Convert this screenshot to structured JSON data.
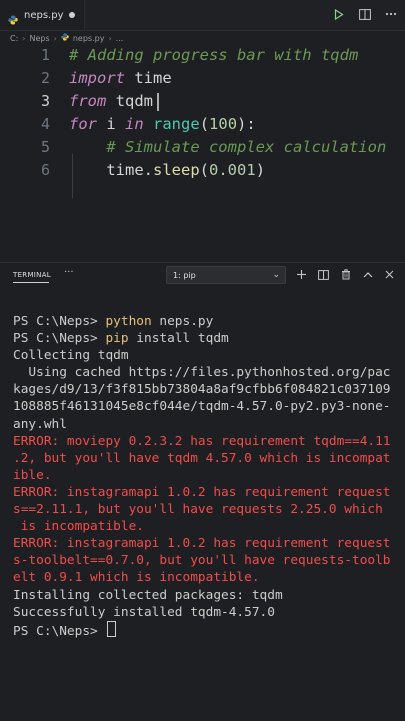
{
  "tabbar": {
    "tab_name": "neps.py",
    "icons": [
      "python-icon",
      "dirty-dot-icon",
      "run-icon",
      "split-editor-icon",
      "more-icon"
    ]
  },
  "breadcrumb": {
    "drive": "C:",
    "folder": "Neps",
    "file": "neps.py",
    "tail": "..."
  },
  "editor": {
    "active_line": 3,
    "lines": [
      {
        "n": "1",
        "segs": [
          {
            "t": "# Adding progress bar with tqdm",
            "c": "cm"
          }
        ]
      },
      {
        "n": "2",
        "segs": [
          {
            "t": "import",
            "c": "kw"
          },
          {
            "t": " time",
            "c": "pl"
          }
        ]
      },
      {
        "n": "3",
        "segs": [
          {
            "t": "from",
            "c": "kw"
          },
          {
            "t": " tqdm",
            "c": "pl"
          }
        ]
      },
      {
        "n": "4",
        "segs": [
          {
            "t": "for",
            "c": "kw"
          },
          {
            "t": " i ",
            "c": "pl"
          },
          {
            "t": "in",
            "c": "kw"
          },
          {
            "t": " ",
            "c": "pl"
          },
          {
            "t": "range",
            "c": "bi"
          },
          {
            "t": "(",
            "c": "pl"
          },
          {
            "t": "100",
            "c": "num"
          },
          {
            "t": "):",
            "c": "pl"
          }
        ]
      },
      {
        "n": "5",
        "segs": [
          {
            "t": "    # Simulate complex calculation",
            "c": "cm"
          }
        ]
      },
      {
        "n": "6",
        "segs": [
          {
            "t": "    time.",
            "c": "pl"
          },
          {
            "t": "sleep",
            "c": "fn"
          },
          {
            "t": "(",
            "c": "pl"
          },
          {
            "t": "0.001",
            "c": "num"
          },
          {
            "t": ")",
            "c": "pl"
          }
        ]
      }
    ]
  },
  "panel": {
    "title": "TERMINAL",
    "more": "···",
    "select_value": "1: pip",
    "actions": [
      "add-terminal-icon",
      "split-terminal-icon",
      "trash-icon",
      "maximize-icon",
      "close-icon"
    ]
  },
  "terminal": {
    "lines": [
      {
        "segs": [
          {
            "t": "PS C:\\Neps> ",
            "c": ""
          },
          {
            "t": "python",
            "c": "ycmd"
          },
          {
            "t": " neps.py",
            "c": ""
          }
        ]
      },
      {
        "segs": [
          {
            "t": "PS C:\\Neps> ",
            "c": ""
          },
          {
            "t": "pip",
            "c": "ycmd"
          },
          {
            "t": " install tqdm",
            "c": ""
          }
        ]
      },
      {
        "segs": [
          {
            "t": "Collecting tqdm",
            "c": ""
          }
        ]
      },
      {
        "segs": [
          {
            "t": "  Using cached https://files.pythonhosted.org/pac",
            "c": ""
          }
        ]
      },
      {
        "segs": [
          {
            "t": "kages/d9/13/f3f815bb73804a8af9cfbb6f084821c037109",
            "c": ""
          }
        ]
      },
      {
        "segs": [
          {
            "t": "108885f46131045e8cf044e/tqdm-4.57.0-py2.py3-none-",
            "c": ""
          }
        ]
      },
      {
        "segs": [
          {
            "t": "any.whl",
            "c": ""
          }
        ]
      },
      {
        "segs": [
          {
            "t": "ERROR: moviepy 0.2.3.2 has requirement tqdm==4.11",
            "c": "err"
          }
        ]
      },
      {
        "segs": [
          {
            "t": ".2, but you'll have tqdm 4.57.0 which is incompat",
            "c": "err"
          }
        ]
      },
      {
        "segs": [
          {
            "t": "ible.",
            "c": "err"
          }
        ]
      },
      {
        "segs": [
          {
            "t": "ERROR: instagramapi 1.0.2 has requirement request",
            "c": "err"
          }
        ]
      },
      {
        "segs": [
          {
            "t": "s==2.11.1, but you'll have requests 2.25.0 which",
            "c": "err"
          }
        ]
      },
      {
        "segs": [
          {
            "t": " is incompatible.",
            "c": "err"
          }
        ]
      },
      {
        "segs": [
          {
            "t": "ERROR: instagramapi 1.0.2 has requirement request",
            "c": "err"
          }
        ]
      },
      {
        "segs": [
          {
            "t": "s-toolbelt==0.7.0, but you'll have requests-toolb",
            "c": "err"
          }
        ]
      },
      {
        "segs": [
          {
            "t": "elt 0.9.1 which is incompatible.",
            "c": "err"
          }
        ]
      },
      {
        "segs": [
          {
            "t": "Installing collected packages: tqdm",
            "c": ""
          }
        ]
      },
      {
        "segs": [
          {
            "t": "Successfully installed tqdm-4.57.0",
            "c": ""
          }
        ]
      },
      {
        "segs": [
          {
            "t": "PS C:\\Neps> ",
            "c": ""
          }
        ],
        "cursor": true
      }
    ]
  }
}
